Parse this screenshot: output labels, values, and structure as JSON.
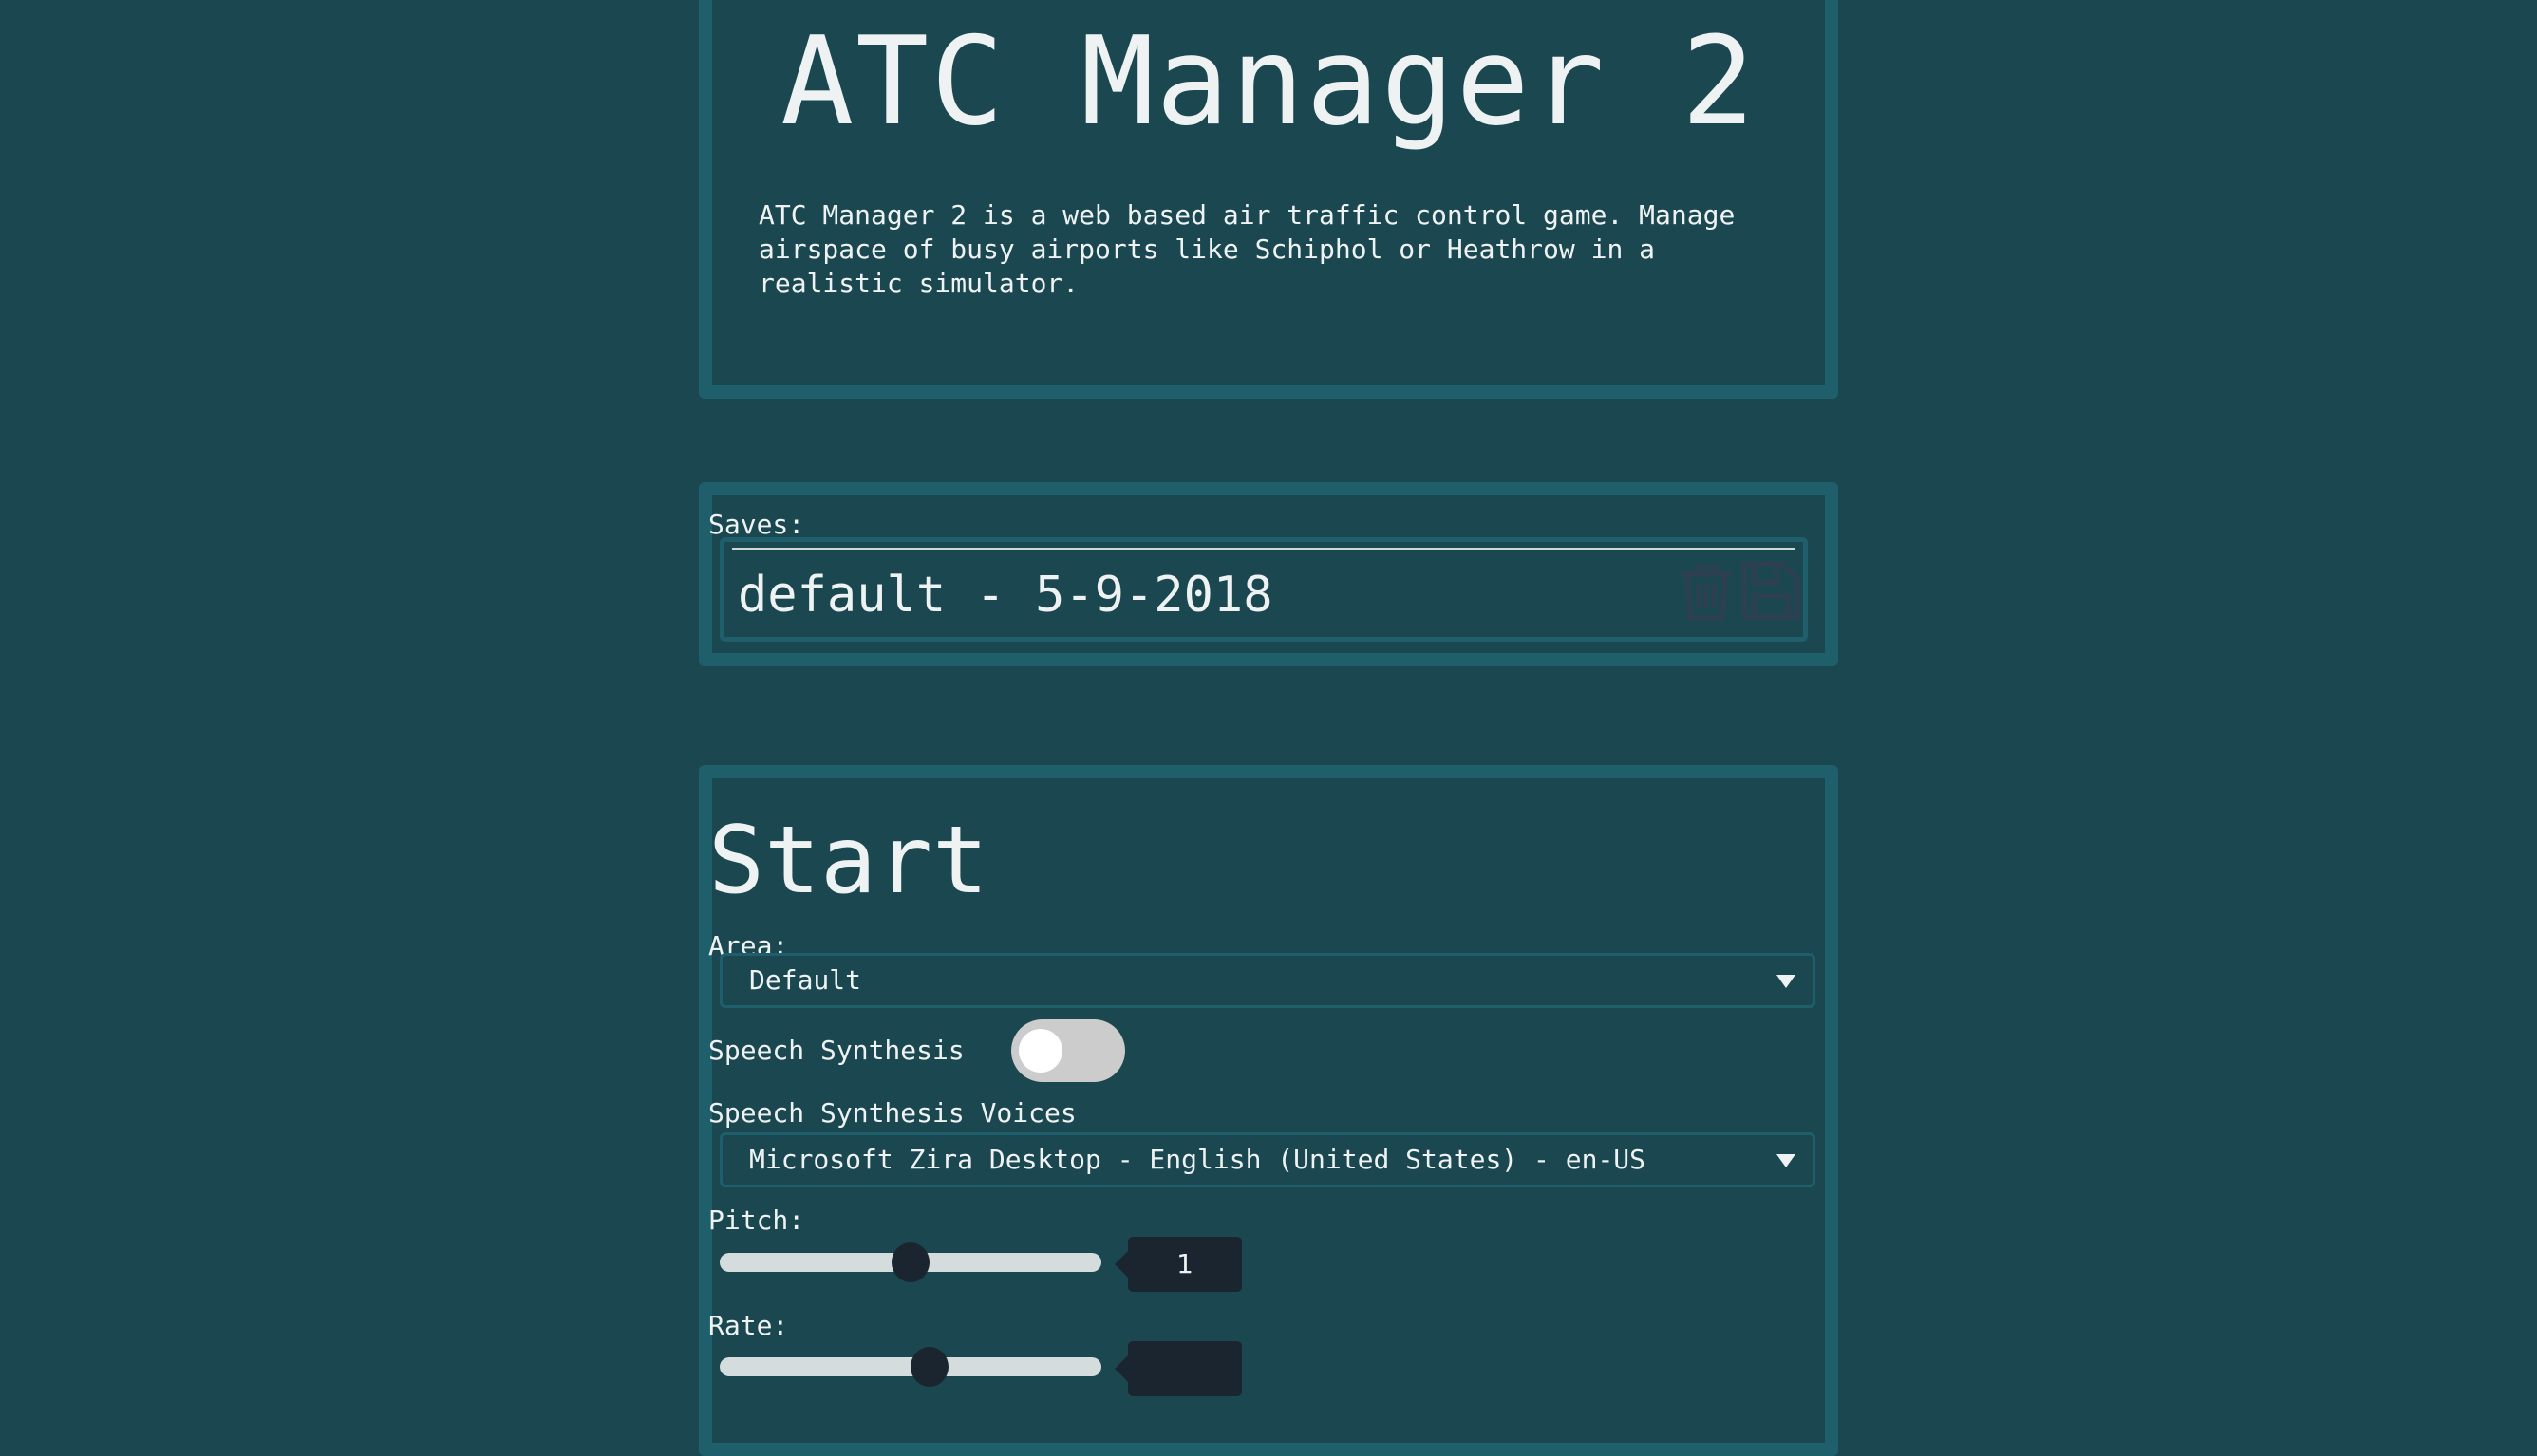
{
  "header": {
    "title": "ATC Manager 2",
    "description": "ATC Manager 2 is a web based air traffic control game. Manage airspace of busy airports like Schiphol or Heathrow in a realistic simulator."
  },
  "saves": {
    "label": "Saves:",
    "items": [
      {
        "name": "default - 5-9-2018",
        "icons": [
          "trash-icon",
          "floppy-disk-icon"
        ]
      }
    ]
  },
  "start": {
    "title": "Start",
    "area": {
      "label": "Area:",
      "value": "Default"
    },
    "speech": {
      "label": "Speech Synthesis",
      "enabled": false
    },
    "voices": {
      "label": "Speech Synthesis Voices",
      "value": "Microsoft Zira Desktop - English (United States) - en-US"
    },
    "pitch": {
      "label": "Pitch:",
      "value": "1",
      "fraction": 0.5
    },
    "rate": {
      "label": "Rate:",
      "fraction": 0.55
    }
  },
  "colors": {
    "background": "#1b4850",
    "border": "#1e5f6b",
    "slider_thumb": "#1b2530",
    "icon": "#2f3f52"
  }
}
